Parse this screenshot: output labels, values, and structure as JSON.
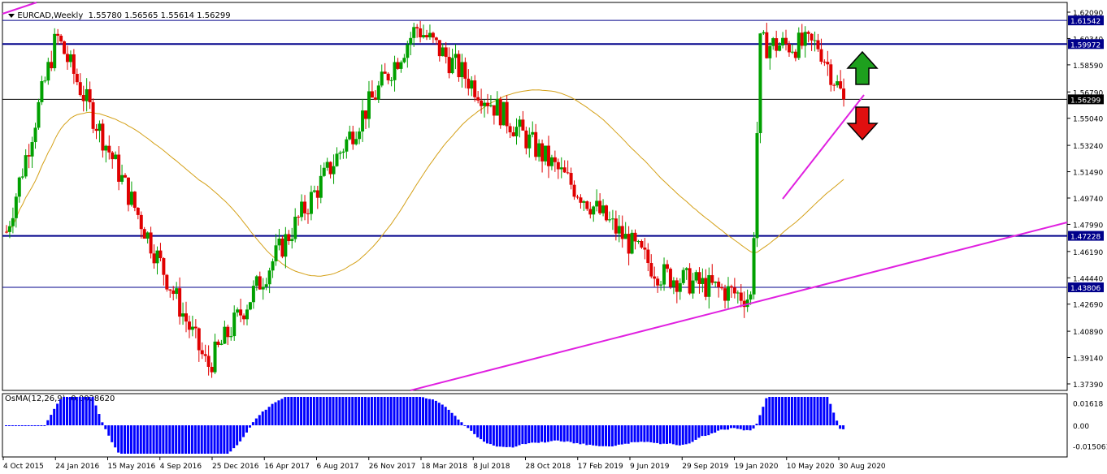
{
  "header": {
    "symbol": "EURCAD,Weekly",
    "ohlc": "1.55780 1.56565 1.55614 1.56299"
  },
  "osma_header": {
    "label": "OsMA(12,26,9) -0.0028620"
  },
  "colors": {
    "bull": "#00a000",
    "bear": "#e00000",
    "ma": "#d4a017",
    "trend": "#e020e0",
    "hline": "#00008b",
    "osma": "#0000ff",
    "arrow_up": "#1ea01e",
    "arrow_down": "#e01010"
  },
  "chart_data": {
    "type": "candlestick",
    "title": "EURCAD,Weekly",
    "price_axis": {
      "ylim": [
        1.3739,
        1.6209
      ],
      "ticks": [
        "1.62090",
        "1.60340",
        "1.58590",
        "1.56790",
        "1.55040",
        "1.53240",
        "1.51490",
        "1.49740",
        "1.47990",
        "1.46190",
        "1.44440",
        "1.42690",
        "1.40890",
        "1.39140",
        "1.37390"
      ]
    },
    "time_axis": {
      "labels": [
        "4 Oct 2015",
        "24 Jan 2016",
        "15 May 2016",
        "4 Sep 2016",
        "25 Dec 2016",
        "16 Apr 2017",
        "6 Aug 2017",
        "26 Nov 2017",
        "18 Mar 2018",
        "8 Jul 2018",
        "28 Oct 2018",
        "17 Feb 2019",
        "9 Jun 2019",
        "29 Sep 2019",
        "19 Jan 2020",
        "10 May 2020",
        "30 Aug 2020"
      ]
    },
    "price_labels": [
      {
        "value": 1.61542,
        "label": "1.61542",
        "style": "line"
      },
      {
        "value": 1.59972,
        "label": "1.59972",
        "style": "level"
      },
      {
        "value": 1.56299,
        "label": "1.56299",
        "style": "current"
      },
      {
        "value": 1.47228,
        "label": "1.47228",
        "style": "level"
      },
      {
        "value": 1.43806,
        "label": "1.43806",
        "style": "line"
      }
    ],
    "key_points": [
      {
        "date": "4 Oct 2015",
        "price": 1.475
      },
      {
        "date": "Feb 2016",
        "price": 1.605
      },
      {
        "date": "Dec 2016",
        "price": 1.385
      },
      {
        "date": "Jan 2018",
        "price": 1.611
      },
      {
        "date": "Aug 2019",
        "price": 1.447
      },
      {
        "date": "Mar 2020",
        "price": 1.431
      },
      {
        "date": "Mar 2020 high",
        "price": 1.599
      },
      {
        "date": "Jun 2020",
        "price": 1.599
      },
      {
        "date": "Sep 2020",
        "price": 1.56299
      }
    ],
    "osma": {
      "name": "OsMA(12,26,9)",
      "last": -0.002862,
      "ticks": [
        "0.01618",
        "0.00",
        "-0.015061"
      ],
      "ylim": [
        -0.0205,
        0.0205
      ]
    },
    "annotations": [
      "up-arrow",
      "down-arrow",
      "rising-trendline",
      "short-trendline",
      "moving-average"
    ]
  }
}
